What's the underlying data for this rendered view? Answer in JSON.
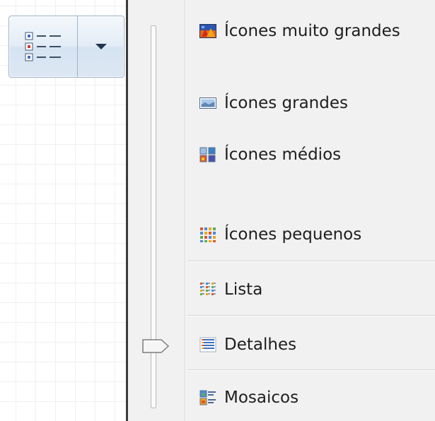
{
  "view_button": {
    "main_icon": "details-view-icon",
    "dropdown_icon": "dropdown-arrow-icon"
  },
  "menu": {
    "slider_level": "Detalhes",
    "items": [
      {
        "label": "Ícones muito grandes",
        "icon": "extra-large-icons-icon"
      },
      {
        "label": "Ícones grandes",
        "icon": "large-icons-icon"
      },
      {
        "label": "Ícones médios",
        "icon": "medium-icons-icon"
      },
      {
        "label": "Ícones pequenos",
        "icon": "small-icons-icon"
      },
      {
        "label": "Lista",
        "icon": "list-view-icon"
      },
      {
        "label": "Detalhes",
        "icon": "details-view-icon"
      },
      {
        "label": "Mosaicos",
        "icon": "tiles-view-icon"
      }
    ]
  }
}
